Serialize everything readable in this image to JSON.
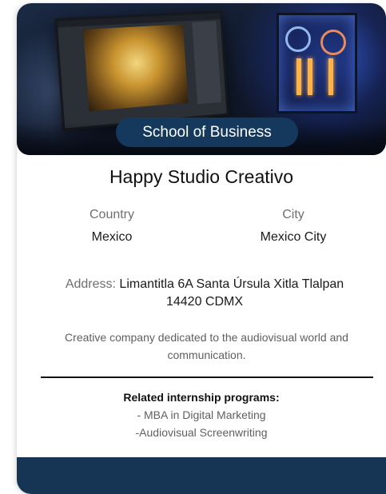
{
  "hero": {
    "image": "studio-workstation-photo",
    "badge": "School of Business"
  },
  "company": {
    "name": "Happy Studio Creativo",
    "country_label": "Country",
    "country": "Mexico",
    "city_label": "City",
    "city": "Mexico City",
    "address_label": "Address:",
    "address": "Limantitla 6A Santa Úrsula Xitla Tlalpan 14420 CDMX",
    "description": "Creative company dedicated to the audiovisual world and communication."
  },
  "programs": {
    "heading": "Related internship programs:",
    "items": [
      "- MBA in Digital Marketing",
      "-Audiovisual Screenwriting"
    ]
  },
  "colors": {
    "badge_bg": "#14395c",
    "footer_bg": "#163554"
  }
}
